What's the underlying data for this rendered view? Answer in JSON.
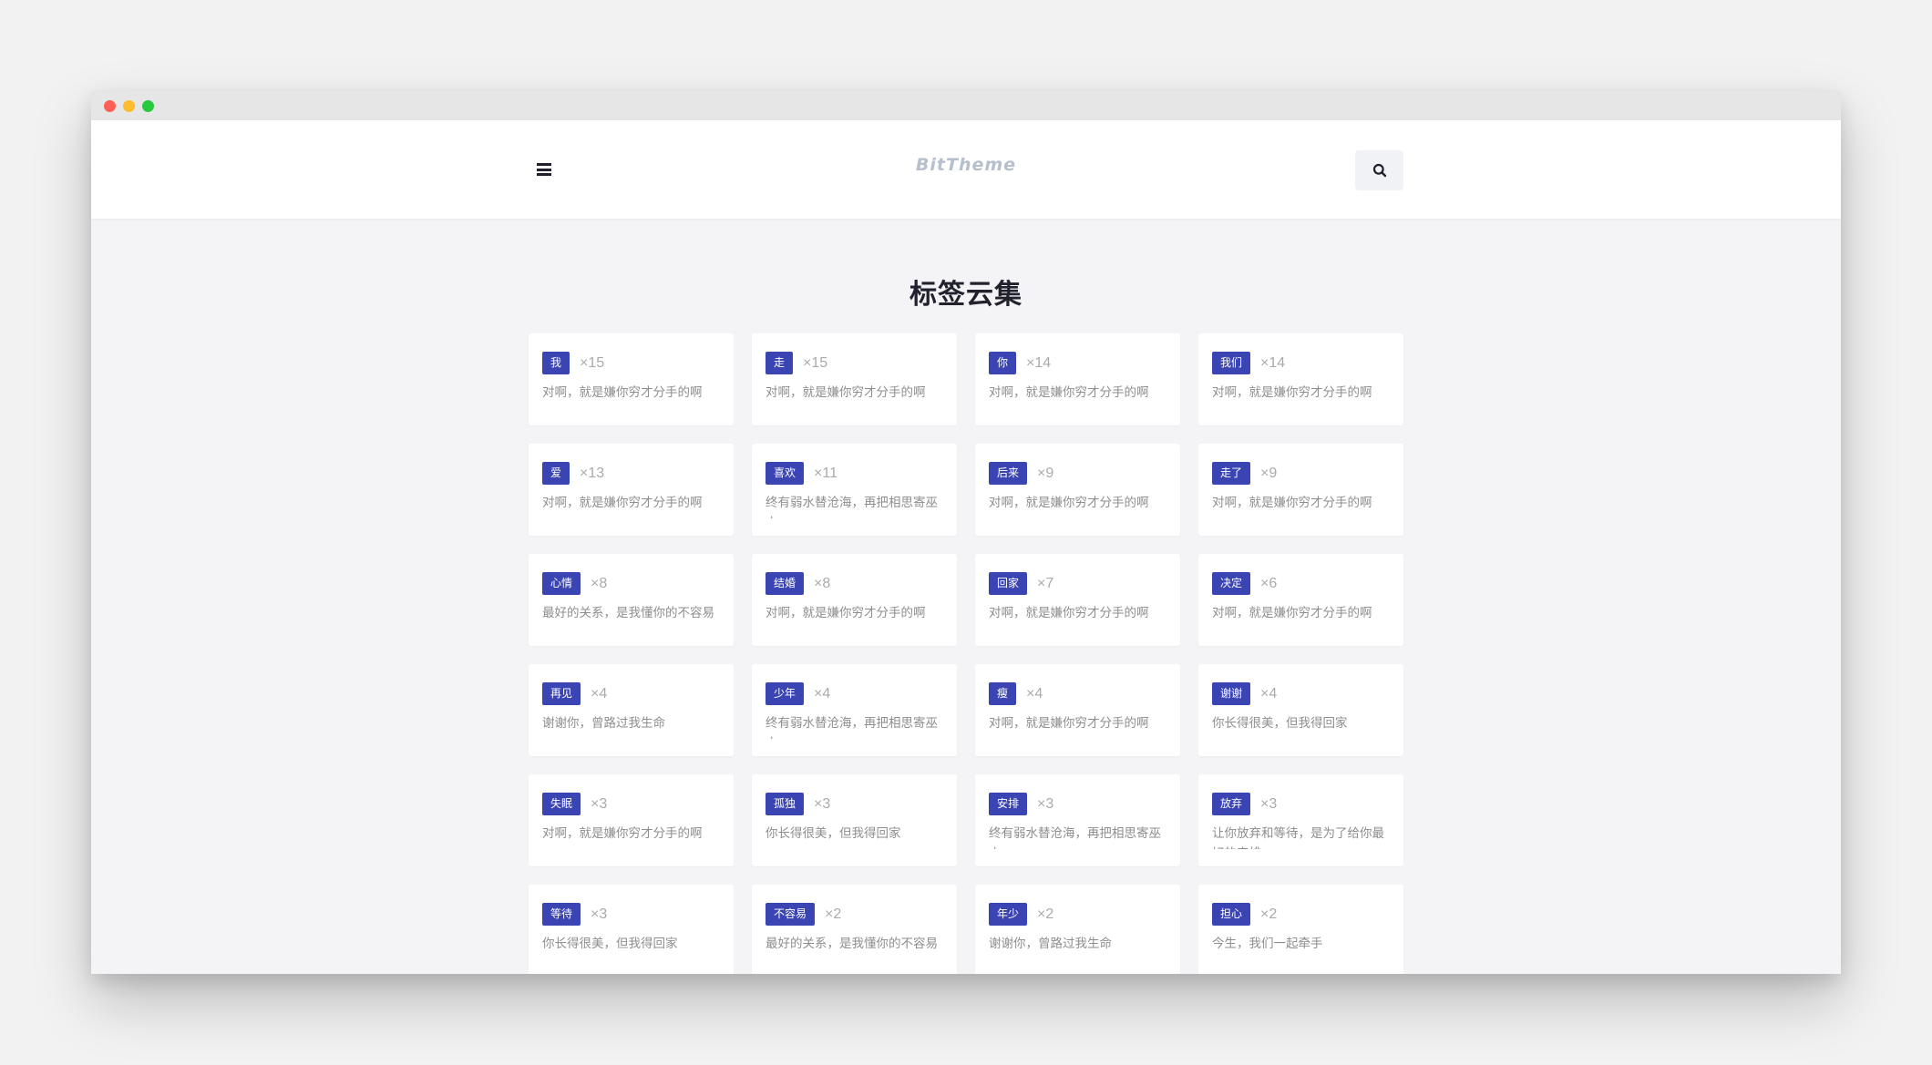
{
  "header": {
    "logo": "BitTheme"
  },
  "page": {
    "title": "标签云集"
  },
  "colors": {
    "tag_bg": "#3a44b3",
    "window_red": "#fe5f57",
    "window_yellow": "#febc2e",
    "window_green": "#28c840"
  },
  "icons": {
    "menu": "hamburger-icon",
    "search": "search-icon"
  },
  "tags": [
    {
      "name": "我",
      "count": "×15",
      "desc": "对啊，就是嫌你穷才分手的啊"
    },
    {
      "name": "走",
      "count": "×15",
      "desc": "对啊，就是嫌你穷才分手的啊"
    },
    {
      "name": "你",
      "count": "×14",
      "desc": "对啊，就是嫌你穷才分手的啊"
    },
    {
      "name": "我们",
      "count": "×14",
      "desc": "对啊，就是嫌你穷才分手的啊"
    },
    {
      "name": "爱",
      "count": "×13",
      "desc": "对啊，就是嫌你穷才分手的啊"
    },
    {
      "name": "喜欢",
      "count": "×11",
      "desc": "终有弱水替沧海，再把相思寄巫山"
    },
    {
      "name": "后来",
      "count": "×9",
      "desc": "对啊，就是嫌你穷才分手的啊"
    },
    {
      "name": "走了",
      "count": "×9",
      "desc": "对啊，就是嫌你穷才分手的啊"
    },
    {
      "name": "心情",
      "count": "×8",
      "desc": "最好的关系，是我懂你的不容易"
    },
    {
      "name": "结婚",
      "count": "×8",
      "desc": "对啊，就是嫌你穷才分手的啊"
    },
    {
      "name": "回家",
      "count": "×7",
      "desc": "对啊，就是嫌你穷才分手的啊"
    },
    {
      "name": "决定",
      "count": "×6",
      "desc": "对啊，就是嫌你穷才分手的啊"
    },
    {
      "name": "再见",
      "count": "×4",
      "desc": "谢谢你，曾路过我生命"
    },
    {
      "name": "少年",
      "count": "×4",
      "desc": "终有弱水替沧海，再把相思寄巫山"
    },
    {
      "name": "瘦",
      "count": "×4",
      "desc": "对啊，就是嫌你穷才分手的啊"
    },
    {
      "name": "谢谢",
      "count": "×4",
      "desc": "你长得很美，但我得回家"
    },
    {
      "name": "失眠",
      "count": "×3",
      "desc": "对啊，就是嫌你穷才分手的啊"
    },
    {
      "name": "孤独",
      "count": "×3",
      "desc": "你长得很美，但我得回家"
    },
    {
      "name": "安排",
      "count": "×3",
      "desc": "终有弱水替沧海，再把相思寄巫山"
    },
    {
      "name": "放弃",
      "count": "×3",
      "desc": "让你放弃和等待，是为了给你最好的安排"
    },
    {
      "name": "等待",
      "count": "×3",
      "desc": "你长得很美，但我得回家"
    },
    {
      "name": "不容易",
      "count": "×2",
      "desc": "最好的关系，是我懂你的不容易"
    },
    {
      "name": "年少",
      "count": "×2",
      "desc": "谢谢你，曾路过我生命"
    },
    {
      "name": "担心",
      "count": "×2",
      "desc": "今生，我们一起牵手"
    }
  ]
}
